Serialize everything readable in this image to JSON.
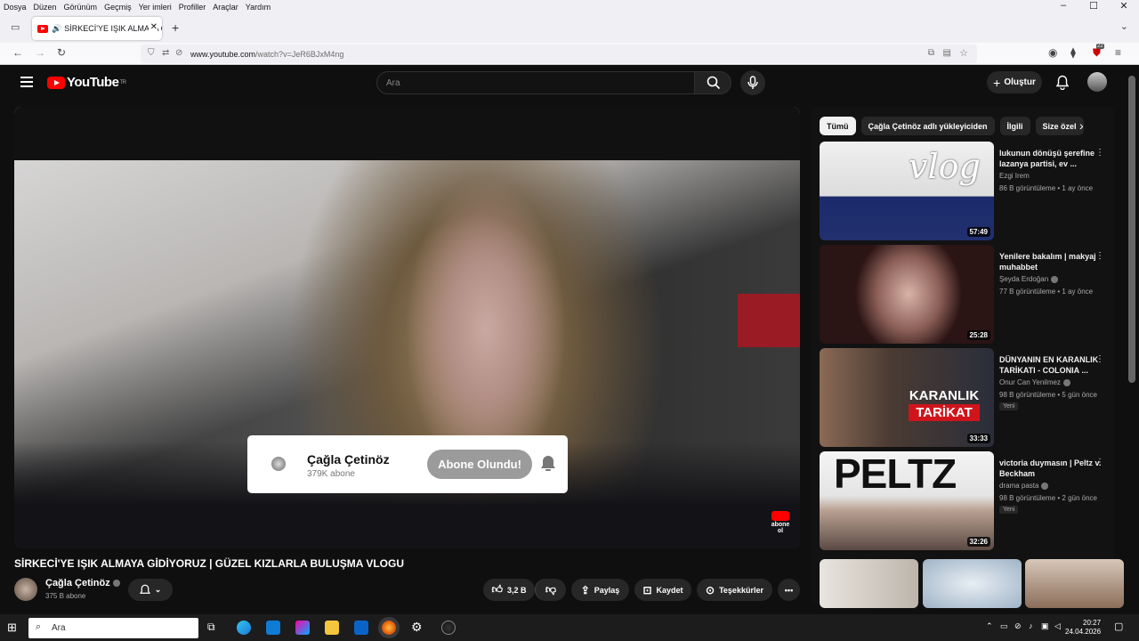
{
  "browser": {
    "menu": [
      "Dosya",
      "Düzen",
      "Görünüm",
      "Geçmiş",
      "Yer imleri",
      "Profiller",
      "Araçlar",
      "Yardım"
    ],
    "tab_title": "SİRKECİ'YE IŞIK ALMAYA Gİ",
    "url_domain": "www.youtube.com",
    "url_path": "/watch?v=JeR6BJxM4ng",
    "badge_count": "22"
  },
  "masthead": {
    "logo_text": "YouTube",
    "logo_region": "TR",
    "search_placeholder": "Ara",
    "create_label": "Oluştur"
  },
  "player": {
    "sub_card": {
      "channel": "Çağla Çetinöz",
      "subs": "379K abone",
      "button": "Abone Olundu!"
    },
    "watermark": "abone ol"
  },
  "video": {
    "title": "SİRKECİ'YE IŞIK ALMAYA GİDİYORUZ | GÜZEL KIZLARLA BULUŞMA VLOGU",
    "channel": "Çağla Çetinöz",
    "subs": "375 B abone",
    "likes": "3,2 B",
    "share": "Paylaş",
    "save": "Kaydet",
    "thanks": "Teşekkürler"
  },
  "sidebar": {
    "chips": [
      "Tümü",
      "Çağla Çetinöz adlı yükleyiciden",
      "İlgili",
      "Size özel"
    ],
    "videos": [
      {
        "title": "lukunun dönüşü şerefine lazanya partisi, ev ...",
        "channel": "Ezgi Irem",
        "meta": "86 B görüntüleme • 1 ay önce",
        "duration": "57:49",
        "thumb_text": "vlog",
        "badge": ""
      },
      {
        "title": "Yenilere bakalım |  makyaj muhabbet",
        "channel": "Şeyda Erdoğan",
        "meta": "77 B görüntüleme • 1 ay önce",
        "duration": "25:28",
        "thumb_text": "",
        "badge": ""
      },
      {
        "title": "DÜNYANIN EN KARANLIK TARİKATI - COLONIA ...",
        "channel": "Onur Can Yenilmez",
        "meta": "98 B görüntüleme • 5 gün önce",
        "duration": "33:33",
        "thumb_text": "KARANLIK TARİKAT",
        "badge": "Yeni"
      },
      {
        "title": "victoria duymasın | Peltz v. Beckham",
        "channel": "drama pasta",
        "meta": "98 B görüntüleme • 2 gün önce",
        "duration": "32:26",
        "thumb_text": "PELTZ",
        "badge": "Yeni"
      }
    ]
  },
  "taskbar": {
    "search": "Ara",
    "time": "20:27",
    "date": "24.04.2026"
  },
  "colors": {
    "youtube_red": "#ff0000",
    "background": "#0f0f0f"
  }
}
